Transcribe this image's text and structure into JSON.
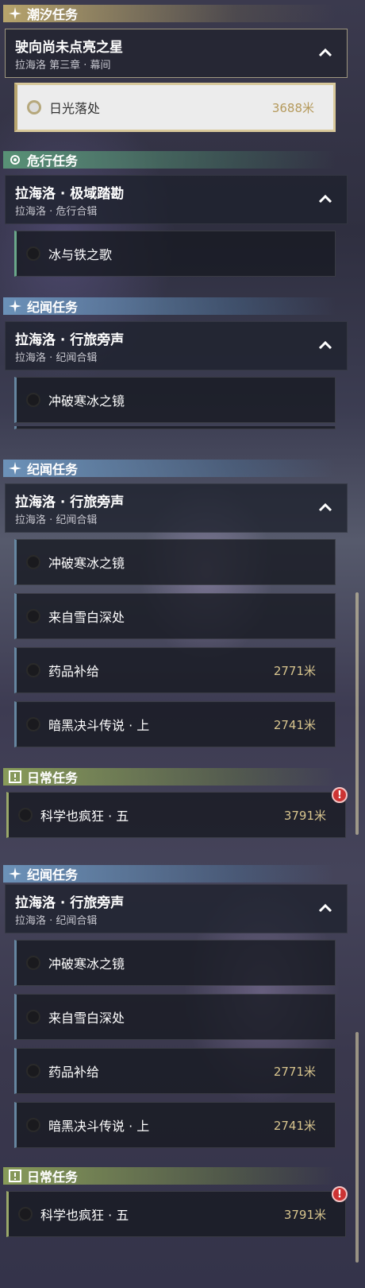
{
  "panel1": {
    "cat_tide": "潮汐任务",
    "group_tide": {
      "title": "驶向尚未点亮之星",
      "subtitle": "拉海洛 第三章 · 幕间"
    },
    "task_sunset": {
      "label": "日光落处",
      "dist": "3688米"
    },
    "cat_danger": "危行任务",
    "group_danger": {
      "title": "拉海洛 · 极域踏勘",
      "subtitle": "拉海洛 · 危行合辑"
    },
    "task_icefire": {
      "label": "冰与铁之歌"
    },
    "cat_record": "纪闻任务",
    "group_record": {
      "title": "拉海洛 · 行旅旁声",
      "subtitle": "拉海洛 · 纪闻合辑"
    },
    "task_mirror": {
      "label": "冲破寒冰之镜"
    }
  },
  "panel2": {
    "cat_record": "纪闻任务",
    "group_record": {
      "title": "拉海洛 · 行旅旁声",
      "subtitle": "拉海洛 · 纪闻合辑"
    },
    "tasks": [
      {
        "label": "冲破寒冰之镜",
        "dist": ""
      },
      {
        "label": "来自雪白深处",
        "dist": ""
      },
      {
        "label": "药品补给",
        "dist": "2771米"
      },
      {
        "label": "暗黑决斗传说 · 上",
        "dist": "2741米"
      }
    ],
    "cat_daily": "日常任务",
    "daily": {
      "label": "科学也疯狂 · 五",
      "dist": "3791米"
    }
  },
  "panel3": {
    "cat_record": "纪闻任务",
    "group_record": {
      "title": "拉海洛 · 行旅旁声",
      "subtitle": "拉海洛 · 纪闻合辑"
    },
    "tasks": [
      {
        "label": "冲破寒冰之镜",
        "dist": ""
      },
      {
        "label": "来自雪白深处",
        "dist": ""
      },
      {
        "label": "药品补给",
        "dist": "2771米"
      },
      {
        "label": "暗黑决斗传说 · 上",
        "dist": "2741米"
      }
    ],
    "cat_daily": "日常任务",
    "daily": {
      "label": "科学也疯狂 · 五",
      "dist": "3791米"
    }
  },
  "colors": {
    "accent_gold": "#d8c58e",
    "warn": "#cc3333"
  }
}
